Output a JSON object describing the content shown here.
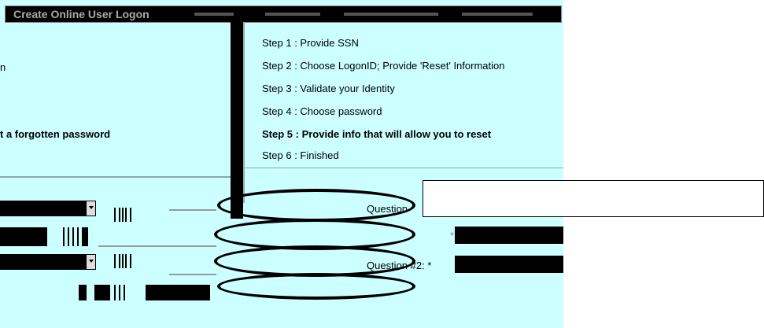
{
  "window": {
    "title": "Create Online User Logon"
  },
  "left": {
    "line1": "n",
    "line2": "t a forgotten password"
  },
  "steps": [
    {
      "label": "Step 1 : Provide SSN",
      "current": false
    },
    {
      "label": "Step 2 : Choose LogonID; Provide 'Reset' Information",
      "current": false
    },
    {
      "label": "Step 3 : Validate your Identity",
      "current": false
    },
    {
      "label": "Step 4 : Choose password",
      "current": false
    },
    {
      "label": "Step 5 : Provide info that will allow you to reset",
      "current": true
    },
    {
      "label": "Step 6 : Finished",
      "current": false
    }
  ],
  "form": {
    "question1_label": "Question",
    "question2_label": "Question #2: *",
    "required_mark": "*"
  },
  "colors": {
    "panel_bg": "#ccffff",
    "title_bg": "#000000",
    "ellipse": "#000000"
  }
}
